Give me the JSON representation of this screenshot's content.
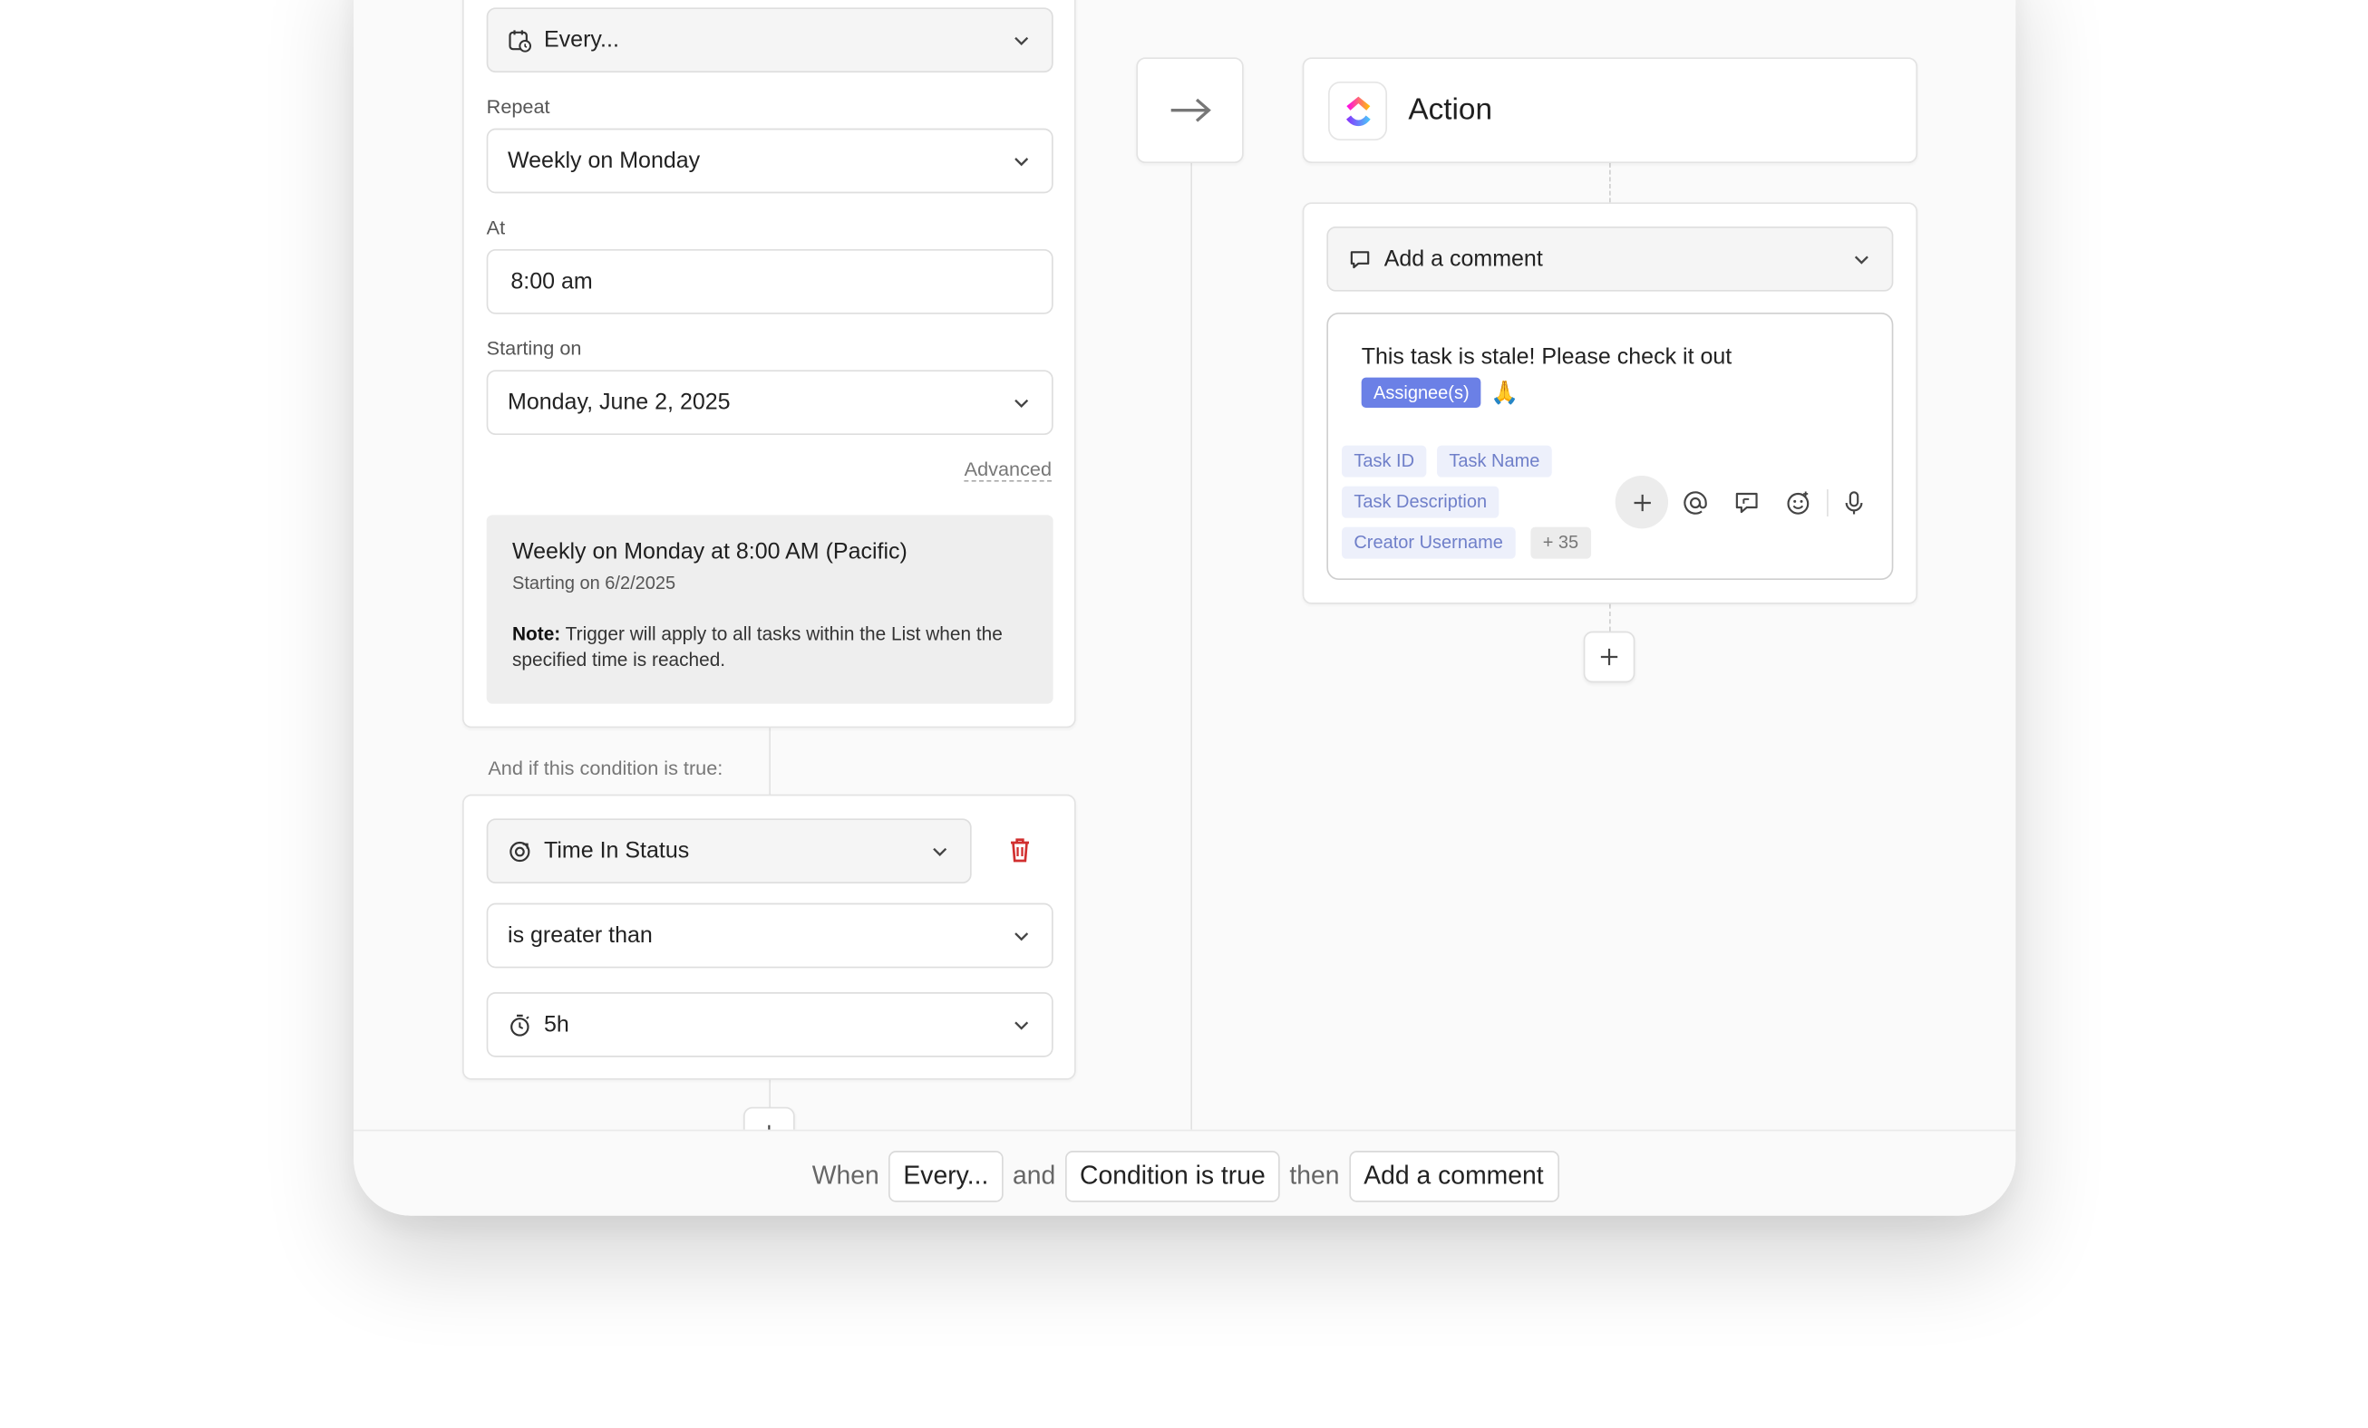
{
  "trigger": {
    "frequency_select": "Every...",
    "repeat": {
      "label": "Repeat",
      "value": "Weekly on Monday"
    },
    "at": {
      "label": "At",
      "value": "8:00 am"
    },
    "starting_on": {
      "label": "Starting on",
      "value": "Monday, June 2, 2025"
    },
    "advanced_link": "Advanced",
    "summary": {
      "title": "Weekly on Monday at 8:00 AM (Pacific)",
      "subtitle": "Starting on 6/2/2025",
      "note_label": "Note:",
      "note_text": "Trigger will apply to all tasks within the List when the specified time is reached."
    }
  },
  "condition": {
    "intro": "And if this condition is true:",
    "field": "Time In Status",
    "operator": "is greater than",
    "value": "5h"
  },
  "action": {
    "title": "Action",
    "type_select": "Add a comment",
    "comment": {
      "text": "This task is stale! Please check it out",
      "assignee_chip": "Assignee(s)",
      "emoji": "🙏"
    },
    "variable_tags": [
      "Task ID",
      "Task Name",
      "Task Description",
      "Creator Username"
    ],
    "more_count": "+ 35"
  },
  "bottom_bar": {
    "when": "When",
    "trigger_chip": "Every...",
    "and": "and",
    "condition_chip": "Condition is true",
    "then": "then",
    "action_chip": "Add a comment"
  },
  "colors": {
    "accent": "#6b80e6",
    "danger": "#d12f2f",
    "tag_bg": "#edf0fb",
    "tag_text": "#6f7fc9"
  },
  "icons": [
    "calendar-clock-icon",
    "chevron-down-icon",
    "arrow-right-icon",
    "clickup-logo",
    "comment-icon",
    "plus-icon",
    "at-icon",
    "comment-reply-icon",
    "emoji-icon",
    "microphone-icon",
    "trash-icon",
    "status-target-icon",
    "timer-icon"
  ]
}
